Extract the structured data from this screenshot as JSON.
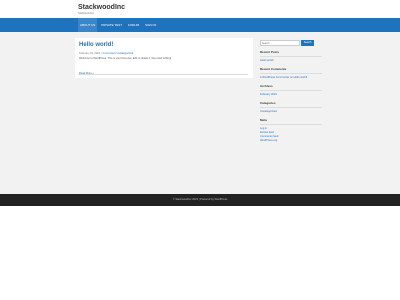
{
  "site": {
    "title": "StackwoodInc",
    "description": "Stackwoodinc"
  },
  "nav": {
    "items": [
      {
        "label": "About us"
      },
      {
        "label": "Private Test"
      },
      {
        "label": "Forum"
      },
      {
        "label": "Sign In"
      }
    ]
  },
  "post": {
    "title": "Hello world!",
    "date": "February 24, 2023",
    "separator": " | ",
    "comment_link": "1 Comment",
    "category": "Uncategorized",
    "excerpt": "Welcome to WordPress. This is your first post. Edit or delete it, then start writing!",
    "read_more": "Read More »"
  },
  "sidebar": {
    "search_placeholder": "Search ...",
    "search_button": "Search",
    "recent_posts": {
      "title": "Recent Posts",
      "items": [
        "Hello world!"
      ]
    },
    "recent_comments": {
      "title": "Recent Comments",
      "items": [
        "A WordPress Commenter on Hello world!"
      ]
    },
    "archives": {
      "title": "Archives",
      "items": [
        "February 2023"
      ]
    },
    "categories": {
      "title": "Categories",
      "items": [
        "Uncategorized"
      ]
    },
    "meta": {
      "title": "Meta",
      "items": [
        "Log in",
        "Entries feed",
        "Comments feed",
        "WordPress.org"
      ]
    }
  },
  "footer": {
    "text": "© StackwoodInc 2023 | Powered by WordPress"
  },
  "colors": {
    "accent": "#1e73be",
    "footer_bg": "#222222",
    "content_bg": "#f2f2f2"
  }
}
